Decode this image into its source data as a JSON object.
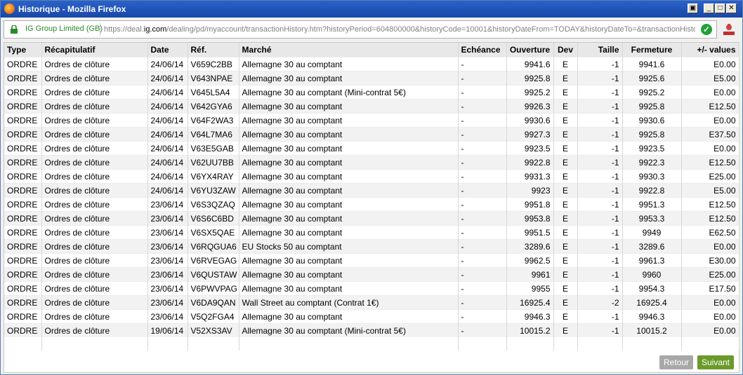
{
  "window": {
    "title": "Historique - Mozilla Firefox"
  },
  "urlbar": {
    "site_identity": "IG Group Limited (GB)",
    "url_prefix": "https://deal.",
    "url_domain": "ig.com",
    "url_rest": "/dealing/pd/myaccount/transactionHistory.htm?historyPeriod=604800000&historyCode=10001&historyDateFrom=TODAY&historyDateTo=&transactionHisto"
  },
  "table": {
    "headers": [
      "Type",
      "Récapitulatif",
      "Date",
      "Réf.",
      "Marché",
      "Echéance",
      "Ouverture",
      "Dev",
      "Taille",
      "Fermeture",
      "+/- values"
    ],
    "rows": [
      [
        "ORDRE",
        "Ordres de clôture",
        "24/06/14",
        "V659C2BB",
        "Allemagne 30 au comptant",
        "-",
        "9941.6",
        "E",
        "-1",
        "9941.6",
        "E0.00"
      ],
      [
        "ORDRE",
        "Ordres de clôture",
        "24/06/14",
        "V643NPAE",
        "Allemagne 30 au comptant",
        "-",
        "9925.8",
        "E",
        "-1",
        "9925.6",
        "E5.00"
      ],
      [
        "ORDRE",
        "Ordres de clôture",
        "24/06/14",
        "V645L5A4",
        "Allemagne 30 au comptant (Mini-contrat 5€)",
        "-",
        "9925.2",
        "E",
        "-1",
        "9925.2",
        "E0.00"
      ],
      [
        "ORDRE",
        "Ordres de clôture",
        "24/06/14",
        "V642GYA6",
        "Allemagne 30 au comptant",
        "-",
        "9926.3",
        "E",
        "-1",
        "9925.8",
        "E12.50"
      ],
      [
        "ORDRE",
        "Ordres de clôture",
        "24/06/14",
        "V64F2WA3",
        "Allemagne 30 au comptant",
        "-",
        "9930.6",
        "E",
        "-1",
        "9930.6",
        "E0.00"
      ],
      [
        "ORDRE",
        "Ordres de clôture",
        "24/06/14",
        "V64L7MA6",
        "Allemagne 30 au comptant",
        "-",
        "9927.3",
        "E",
        "-1",
        "9925.8",
        "E37.50"
      ],
      [
        "ORDRE",
        "Ordres de clôture",
        "24/06/14",
        "V63E5GAB",
        "Allemagne 30 au comptant",
        "-",
        "9923.5",
        "E",
        "-1",
        "9923.5",
        "E0.00"
      ],
      [
        "ORDRE",
        "Ordres de clôture",
        "24/06/14",
        "V62UU7BB",
        "Allemagne 30 au comptant",
        "-",
        "9922.8",
        "E",
        "-1",
        "9922.3",
        "E12.50"
      ],
      [
        "ORDRE",
        "Ordres de clôture",
        "24/06/14",
        "V6YX4RAY",
        "Allemagne 30 au comptant",
        "-",
        "9931.3",
        "E",
        "-1",
        "9930.3",
        "E25.00"
      ],
      [
        "ORDRE",
        "Ordres de clôture",
        "24/06/14",
        "V6YU3ZAW",
        "Allemagne 30 au comptant",
        "-",
        "9923",
        "E",
        "-1",
        "9922.8",
        "E5.00"
      ],
      [
        "ORDRE",
        "Ordres de clôture",
        "23/06/14",
        "V6S3QZAQ",
        "Allemagne 30 au comptant",
        "-",
        "9951.8",
        "E",
        "-1",
        "9951.3",
        "E12.50"
      ],
      [
        "ORDRE",
        "Ordres de clôture",
        "23/06/14",
        "V6S6C6BD",
        "Allemagne 30 au comptant",
        "-",
        "9953.8",
        "E",
        "-1",
        "9953.3",
        "E12.50"
      ],
      [
        "ORDRE",
        "Ordres de clôture",
        "23/06/14",
        "V6SX5QAE",
        "Allemagne 30 au comptant",
        "-",
        "9951.5",
        "E",
        "-1",
        "9949",
        "E62.50"
      ],
      [
        "ORDRE",
        "Ordres de clôture",
        "23/06/14",
        "V6RQGUA6",
        "EU Stocks 50 au comptant",
        "-",
        "3289.6",
        "E",
        "-1",
        "3289.6",
        "E0.00"
      ],
      [
        "ORDRE",
        "Ordres de clôture",
        "23/06/14",
        "V6RVEGAG",
        "Allemagne 30 au comptant",
        "-",
        "9962.5",
        "E",
        "-1",
        "9961.3",
        "E30.00"
      ],
      [
        "ORDRE",
        "Ordres de clôture",
        "23/06/14",
        "V6QUSTAW",
        "Allemagne 30 au comptant",
        "-",
        "9961",
        "E",
        "-1",
        "9960",
        "E25.00"
      ],
      [
        "ORDRE",
        "Ordres de clôture",
        "23/06/14",
        "V6PWVPAG",
        "Allemagne 30 au comptant",
        "-",
        "9955",
        "E",
        "-1",
        "9954.3",
        "E17.50"
      ],
      [
        "ORDRE",
        "Ordres de clôture",
        "23/06/14",
        "V6DA9QAN",
        "Wall Street au comptant (Contrat 1€)",
        "-",
        "16925.4",
        "E",
        "-2",
        "16925.4",
        "E0.00"
      ],
      [
        "ORDRE",
        "Ordres de clôture",
        "23/06/14",
        "V5Q2FGA4",
        "Allemagne 30 au comptant",
        "-",
        "9946.3",
        "E",
        "-1",
        "9946.3",
        "E0.00"
      ],
      [
        "ORDRE",
        "Ordres de clôture",
        "19/06/14",
        "V52XS3AV",
        "Allemagne 30 au comptant (Mini-contrat 5€)",
        "-",
        "10015.2",
        "E",
        "-1",
        "10015.2",
        "E0.00"
      ]
    ]
  },
  "footer": {
    "retour_label": "Retour",
    "suivant_label": "Suivant"
  },
  "colors": {
    "accent_green": "#6a9a2a",
    "disabled_grey": "#a8a8a8",
    "titlebar_blue": "#2b62c9"
  }
}
